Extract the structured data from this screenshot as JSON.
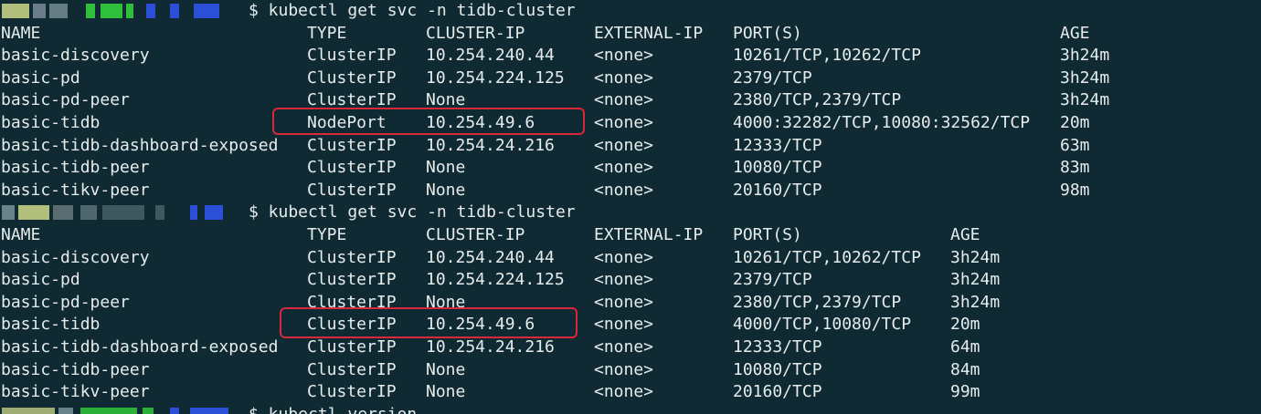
{
  "theme": {
    "background": "#0f2a33",
    "text": "#e6ecec",
    "highlight_border": "#d8283a"
  },
  "block1": {
    "prompt_command": "$ kubectl get svc -n tidb-cluster",
    "headers": [
      "NAME",
      "TYPE",
      "CLUSTER-IP",
      "EXTERNAL-IP",
      "PORT(S)",
      "AGE"
    ],
    "rows": [
      [
        "basic-discovery",
        "ClusterIP",
        "10.254.240.44",
        "<none>",
        "10261/TCP,10262/TCP",
        "3h24m"
      ],
      [
        "basic-pd",
        "ClusterIP",
        "10.254.224.125",
        "<none>",
        "2379/TCP",
        "3h24m"
      ],
      [
        "basic-pd-peer",
        "ClusterIP",
        "None",
        "<none>",
        "2380/TCP,2379/TCP",
        "3h24m"
      ],
      [
        "basic-tidb",
        "NodePort",
        "10.254.49.6",
        "<none>",
        "4000:32282/TCP,10080:32562/TCP",
        "20m"
      ],
      [
        "basic-tidb-dashboard-exposed",
        "ClusterIP",
        "10.254.24.216",
        "<none>",
        "12333/TCP",
        "63m"
      ],
      [
        "basic-tidb-peer",
        "ClusterIP",
        "None",
        "<none>",
        "10080/TCP",
        "83m"
      ],
      [
        "basic-tikv-peer",
        "ClusterIP",
        "None",
        "<none>",
        "20160/TCP",
        "98m"
      ]
    ]
  },
  "block2": {
    "prompt_command": "$ kubectl get svc -n tidb-cluster",
    "headers": [
      "NAME",
      "TYPE",
      "CLUSTER-IP",
      "EXTERNAL-IP",
      "PORT(S)",
      "AGE"
    ],
    "rows": [
      [
        "basic-discovery",
        "ClusterIP",
        "10.254.240.44",
        "<none>",
        "10261/TCP,10262/TCP",
        "3h24m"
      ],
      [
        "basic-pd",
        "ClusterIP",
        "10.254.224.125",
        "<none>",
        "2379/TCP",
        "3h24m"
      ],
      [
        "basic-pd-peer",
        "ClusterIP",
        "None",
        "<none>",
        "2380/TCP,2379/TCP",
        "3h24m"
      ],
      [
        "basic-tidb",
        "ClusterIP",
        "10.254.49.6",
        "<none>",
        "4000/TCP,10080/TCP",
        "20m"
      ],
      [
        "basic-tidb-dashboard-exposed",
        "ClusterIP",
        "10.254.24.216",
        "<none>",
        "12333/TCP",
        "64m"
      ],
      [
        "basic-tidb-peer",
        "ClusterIP",
        "None",
        "<none>",
        "10080/TCP",
        "84m"
      ],
      [
        "basic-tikv-peer",
        "ClusterIP",
        "None",
        "<none>",
        "20160/TCP",
        "99m"
      ]
    ]
  },
  "block3": {
    "prompt_command": "$ kubectl version"
  }
}
